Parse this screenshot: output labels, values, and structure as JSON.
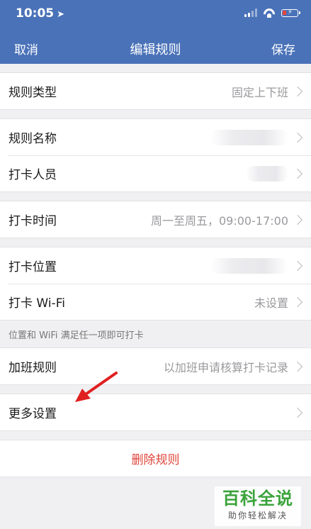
{
  "status_bar": {
    "time": "10:05",
    "location_glyph": "➤"
  },
  "colors": {
    "nav": "#4a72b8",
    "delete": "#e0443a",
    "arrow": "#e02020",
    "watermark": "#3aa33a"
  },
  "nav": {
    "cancel": "取消",
    "title": "编辑规则",
    "save": "保存"
  },
  "rows": {
    "rule_type": {
      "label": "规则类型",
      "value": "固定上下班"
    },
    "rule_name": {
      "label": "规则名称"
    },
    "members": {
      "label": "打卡人员"
    },
    "clock_time": {
      "label": "打卡时间",
      "value": "周一至周五，09:00-17:00"
    },
    "location": {
      "label": "打卡位置"
    },
    "wifi": {
      "label": "打卡 Wi-Fi",
      "value": "未设置"
    },
    "overtime": {
      "label": "加班规则",
      "value": "以加班申请核算打卡记录"
    },
    "more": {
      "label": "更多设置"
    }
  },
  "hint": "位置和 WiFi 满足任一项即可打卡",
  "delete_label": "删除规则",
  "watermark": {
    "title": "百科全说",
    "subtitle": "助你轻松解决"
  }
}
